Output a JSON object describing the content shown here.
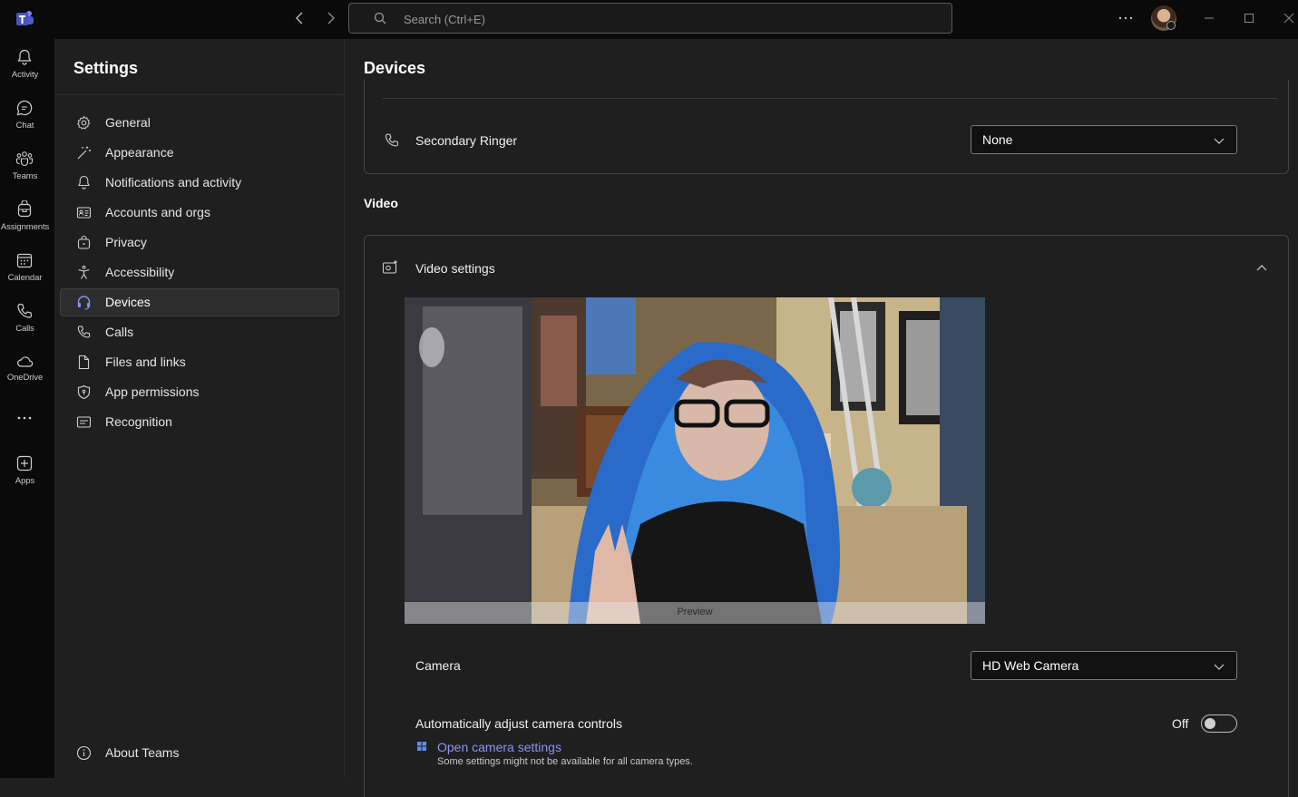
{
  "titlebar": {
    "search_placeholder": "Search (Ctrl+E)"
  },
  "rail": {
    "items": [
      {
        "label": "Activity",
        "icon": "bell-icon"
      },
      {
        "label": "Chat",
        "icon": "chat-icon"
      },
      {
        "label": "Teams",
        "icon": "teams-icon"
      },
      {
        "label": "Assignments",
        "icon": "backpack-icon"
      },
      {
        "label": "Calendar",
        "icon": "calendar-icon"
      },
      {
        "label": "Calls",
        "icon": "phone-icon"
      },
      {
        "label": "OneDrive",
        "icon": "cloud-icon"
      },
      {
        "label": "Apps",
        "icon": "plus-icon"
      }
    ]
  },
  "settings": {
    "title": "Settings",
    "items": [
      {
        "label": "General",
        "icon": "gear-icon"
      },
      {
        "label": "Appearance",
        "icon": "wand-icon"
      },
      {
        "label": "Notifications and activity",
        "icon": "bell-icon"
      },
      {
        "label": "Accounts and orgs",
        "icon": "id-card-icon"
      },
      {
        "label": "Privacy",
        "icon": "lock-bag-icon"
      },
      {
        "label": "Accessibility",
        "icon": "accessibility-icon"
      },
      {
        "label": "Devices",
        "icon": "headset-icon",
        "active": true
      },
      {
        "label": "Calls",
        "icon": "phone-icon"
      },
      {
        "label": "Files and links",
        "icon": "file-icon"
      },
      {
        "label": "App permissions",
        "icon": "shield-icon"
      },
      {
        "label": "Recognition",
        "icon": "id-icon"
      }
    ],
    "about": "About Teams"
  },
  "main": {
    "title": "Devices",
    "secondary_ringer": {
      "label": "Secondary Ringer",
      "value": "None"
    },
    "video_section": "Video",
    "video_settings": {
      "title": "Video settings",
      "preview_label": "Preview",
      "camera_label": "Camera",
      "camera_value": "HD Web Camera",
      "auto_adjust_label": "Automatically adjust camera controls",
      "auto_adjust_state": "Off",
      "open_camera_link": "Open camera settings",
      "hint": "Some settings might not be available for all camera types."
    }
  },
  "colors": {
    "accent": "#7f85f5",
    "background": "#1f1f1f",
    "rail": "#0a0a0a",
    "link": "#8e93f2"
  }
}
